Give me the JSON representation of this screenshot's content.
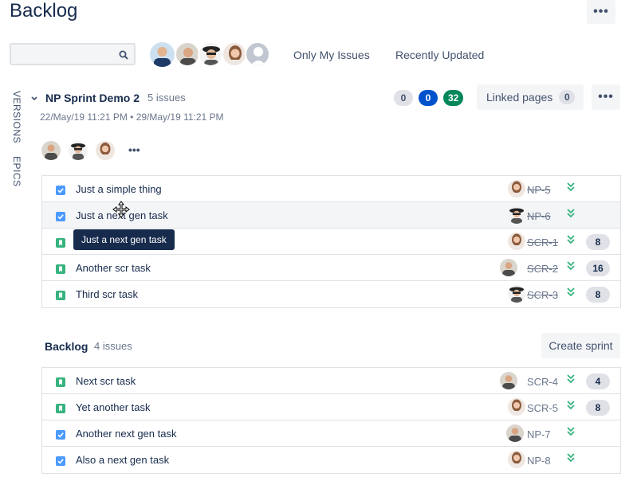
{
  "page": {
    "title": "Backlog"
  },
  "header": {
    "more_label": "•••"
  },
  "filters": {
    "search_placeholder": "",
    "only_my_issues": "Only My Issues",
    "recently_updated": "Recently Updated"
  },
  "side_tabs": {
    "versions": "VERSIONS",
    "epics": "EPICS"
  },
  "sprint": {
    "name": "NP Sprint Demo 2",
    "issue_count": "5 issues",
    "dates": "22/May/19 11:21 PM • 29/May/19 11:21 PM",
    "status_counts": [
      {
        "value": "0",
        "color": "#dfe1e6",
        "text_color": "#42526e"
      },
      {
        "value": "0",
        "color": "#0052cc",
        "text_color": "#ffffff"
      },
      {
        "value": "32",
        "color": "#00875a",
        "text_color": "#ffffff"
      }
    ],
    "linked_pages_label": "Linked pages",
    "linked_pages_count": "0",
    "more_label": "•••",
    "assignees_more": "•••",
    "tooltip": "Just a next gen task",
    "issues": [
      {
        "type": "task",
        "summary": "Just a simple thing",
        "key": "NP-5",
        "done": true,
        "avatar": "woman",
        "estimate": ""
      },
      {
        "type": "task",
        "summary": "Just a next gen task",
        "key": "NP-6",
        "done": true,
        "avatar": "hat",
        "estimate": ""
      },
      {
        "type": "story",
        "summary": "",
        "key": "SCR-1",
        "done": true,
        "avatar": "woman",
        "estimate": "8"
      },
      {
        "type": "story",
        "summary": "Another scr task",
        "key": "SCR-2",
        "done": true,
        "avatar": "man",
        "estimate": "16"
      },
      {
        "type": "story",
        "summary": "Third scr task",
        "key": "SCR-3",
        "done": true,
        "avatar": "hat",
        "estimate": "8"
      }
    ]
  },
  "backlog": {
    "name": "Backlog",
    "issue_count": "4 issues",
    "create_sprint_label": "Create sprint",
    "issues": [
      {
        "type": "story",
        "summary": "Next scr task",
        "key": "SCR-4",
        "done": false,
        "avatar": "man",
        "estimate": "4"
      },
      {
        "type": "story",
        "summary": "Yet another task",
        "key": "SCR-5",
        "done": false,
        "avatar": "woman",
        "estimate": "8"
      },
      {
        "type": "task",
        "summary": "Another next gen task",
        "key": "NP-7",
        "done": false,
        "avatar": "man",
        "estimate": ""
      },
      {
        "type": "task",
        "summary": "Also a next gen task",
        "key": "NP-8",
        "done": false,
        "avatar": "woman",
        "estimate": ""
      }
    ]
  },
  "icons": {
    "task": "checkbox-icon",
    "story": "bookmark-icon",
    "priority": "priority-lowest-icon"
  },
  "colors": {
    "task": "#4c9aff",
    "story": "#36b37e",
    "priority": "#36b37e"
  }
}
